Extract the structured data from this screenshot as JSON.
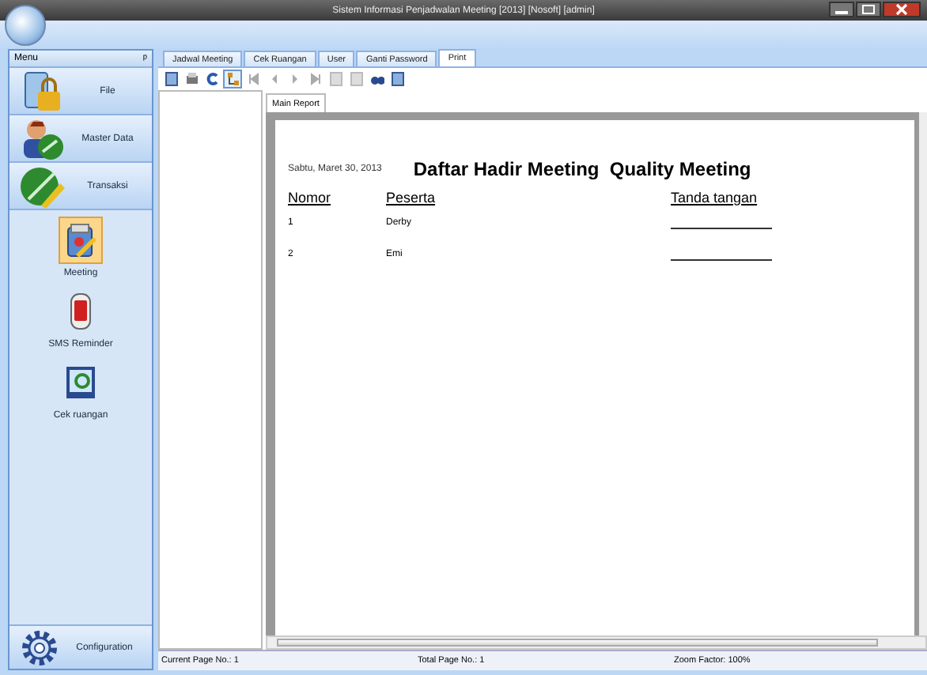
{
  "window": {
    "title": "Sistem Informasi Penjadwalan Meeting [2013] [Nosoft] [admin]"
  },
  "sidebar": {
    "title": "Menu",
    "pin": "ᵖ",
    "groups": [
      {
        "label": "File",
        "kind": "lock"
      },
      {
        "label": "Master Data",
        "kind": "person"
      },
      {
        "label": "Transaksi",
        "kind": "pencil"
      }
    ],
    "items": [
      {
        "label": "Meeting",
        "kind": "notepad",
        "selected": true
      },
      {
        "label": "SMS Reminder",
        "kind": "phone",
        "selected": false
      },
      {
        "label": "Cek ruangan",
        "kind": "picture",
        "selected": false
      }
    ],
    "footer": {
      "label": "Configuration"
    }
  },
  "tabs": [
    {
      "label": "Jadwal Meeting",
      "selected": false
    },
    {
      "label": "Cek Ruangan",
      "selected": false
    },
    {
      "label": "User",
      "selected": false
    },
    {
      "label": "Ganti Password",
      "selected": false
    },
    {
      "label": "Print",
      "selected": true
    }
  ],
  "viewer": {
    "tab": "Main Report",
    "report": {
      "date": "Sabtu, Maret 30, 2013",
      "title": "Daftar Hadir Meeting  Quality Meeting",
      "columns": [
        "Nomor",
        "Peserta",
        "Tanda tangan"
      ],
      "rows": [
        {
          "number": "1",
          "name": "Derby"
        },
        {
          "number": "2",
          "name": "Emi"
        }
      ]
    }
  },
  "status_bar": [
    "Current Page No.: 1",
    "Total Page No.: 1",
    "Zoom Factor: 100%"
  ]
}
